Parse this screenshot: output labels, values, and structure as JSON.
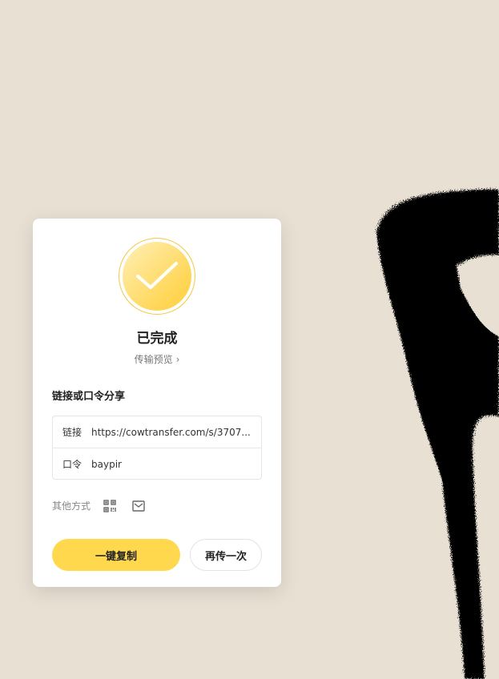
{
  "colors": {
    "background": "#e8e0d3",
    "accent": "#ffd84e",
    "art": "#000000"
  },
  "status": {
    "title": "已完成",
    "preview_link": "传输预览",
    "icon": "check-icon"
  },
  "share": {
    "section_title": "链接或口令分享",
    "link_label": "链接",
    "link_value": "https://cowtransfer.com/s/3707...",
    "code_label": "口令",
    "code_value": "baypir"
  },
  "other": {
    "label": "其他方式",
    "icons": [
      "qrcode-icon",
      "mail-icon"
    ]
  },
  "actions": {
    "copy_label": "一键复制",
    "again_label": "再传一次"
  }
}
